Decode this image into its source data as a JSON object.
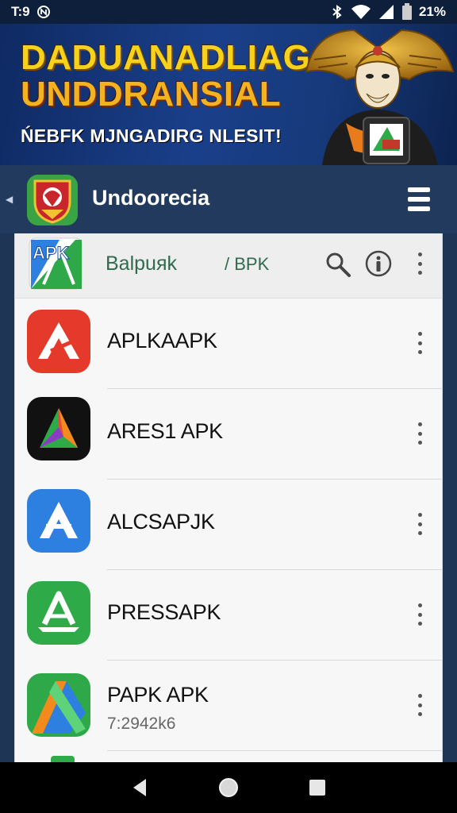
{
  "status_bar": {
    "time": "T:9",
    "notification_icon": "circle-n-icon",
    "battery_text": "21%",
    "icons": [
      "bluetooth-icon",
      "wifi-icon",
      "signal-icon",
      "battery-icon"
    ]
  },
  "banner": {
    "title_line1": "DADUANADLIAG",
    "title_line2": "UNDDRANSIAL",
    "subtitle": "ŃEBFK MJNGADIRG NLESIT!",
    "title_color": "#f6d21b",
    "background_color": "#1a3f8a"
  },
  "header": {
    "title": "Undoorесia",
    "logo_icon": "garuda-shield-icon",
    "menu_icon": "hamburger-icon",
    "back_icon": "chevron-left-icon",
    "background_color": "#223a5d"
  },
  "list_top": {
    "logo_text": "APK",
    "title": "Balpuяk",
    "suffix": "/ BPK",
    "search_icon": "search-icon",
    "info_icon": "info-icon",
    "more_icon": "more-vertical-icon"
  },
  "apps": [
    {
      "name": "APLKAAPK",
      "meta": "",
      "icon": "red-a-icon",
      "icon_color": "#e53a2b"
    },
    {
      "name": "ARES1 APK",
      "meta": "",
      "icon": "black-triangle-icon",
      "icon_color": "#111111"
    },
    {
      "name": "ALCSAPJK",
      "meta": "",
      "icon": "blue-a-icon",
      "icon_color": "#2d7fe0"
    },
    {
      "name": "PRESSAPK",
      "meta": "",
      "icon": "green-a-icon",
      "icon_color": "#2faa48"
    },
    {
      "name": "PAPK APK",
      "meta": "7:2942k6",
      "icon": "green-ribbon-icon",
      "icon_color": "#2fa84a"
    }
  ],
  "nav": {
    "back_icon": "back-triangle-icon",
    "home_icon": "home-circle-icon",
    "recents_icon": "recents-square-icon"
  }
}
